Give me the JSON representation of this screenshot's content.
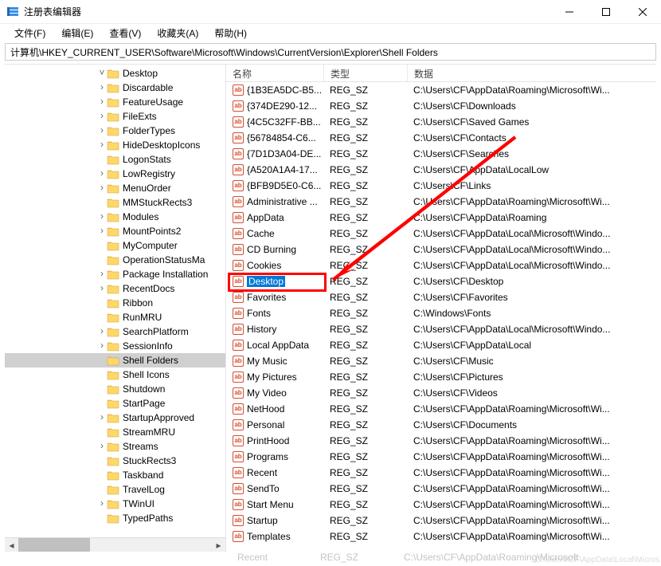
{
  "window": {
    "title": "注册表编辑器",
    "min_label": "minimize",
    "max_label": "maximize",
    "close_label": "close"
  },
  "menu": {
    "file": "文件(F)",
    "edit": "编辑(E)",
    "view": "查看(V)",
    "fav": "收藏夹(A)",
    "help": "帮助(H)"
  },
  "address": "计算机\\HKEY_CURRENT_USER\\Software\\Microsoft\\Windows\\CurrentVersion\\Explorer\\Shell Folders",
  "tree": [
    {
      "label": "Desktop",
      "chev": "v"
    },
    {
      "label": "Discardable",
      "chev": ">"
    },
    {
      "label": "FeatureUsage",
      "chev": ">"
    },
    {
      "label": "FileExts",
      "chev": ">"
    },
    {
      "label": "FolderTypes",
      "chev": ">"
    },
    {
      "label": "HideDesktopIcons",
      "chev": ">"
    },
    {
      "label": "LogonStats",
      "chev": ""
    },
    {
      "label": "LowRegistry",
      "chev": ">"
    },
    {
      "label": "MenuOrder",
      "chev": ">"
    },
    {
      "label": "MMStuckRects3",
      "chev": ""
    },
    {
      "label": "Modules",
      "chev": ">"
    },
    {
      "label": "MountPoints2",
      "chev": ">"
    },
    {
      "label": "MyComputer",
      "chev": ""
    },
    {
      "label": "OperationStatusMa",
      "chev": ""
    },
    {
      "label": "Package Installation",
      "chev": ">"
    },
    {
      "label": "RecentDocs",
      "chev": ">"
    },
    {
      "label": "Ribbon",
      "chev": ""
    },
    {
      "label": "RunMRU",
      "chev": ""
    },
    {
      "label": "SearchPlatform",
      "chev": ">"
    },
    {
      "label": "SessionInfo",
      "chev": ">"
    },
    {
      "label": "Shell Folders",
      "chev": "",
      "selected": true
    },
    {
      "label": "Shell Icons",
      "chev": ""
    },
    {
      "label": "Shutdown",
      "chev": ""
    },
    {
      "label": "StartPage",
      "chev": ""
    },
    {
      "label": "StartupApproved",
      "chev": ">"
    },
    {
      "label": "StreamMRU",
      "chev": ""
    },
    {
      "label": "Streams",
      "chev": ">"
    },
    {
      "label": "StuckRects3",
      "chev": ""
    },
    {
      "label": "Taskband",
      "chev": ""
    },
    {
      "label": "TravelLog",
      "chev": ""
    },
    {
      "label": "TWinUI",
      "chev": ">"
    },
    {
      "label": "TypedPaths",
      "chev": ""
    }
  ],
  "columns": {
    "name": "名称",
    "type": "类型",
    "data": "数据"
  },
  "rows": [
    {
      "name": "{1B3EA5DC-B5...",
      "type": "REG_SZ",
      "data": "C:\\Users\\CF\\AppData\\Roaming\\Microsoft\\Wi..."
    },
    {
      "name": "{374DE290-12...",
      "type": "REG_SZ",
      "data": "C:\\Users\\CF\\Downloads"
    },
    {
      "name": "{4C5C32FF-BB...",
      "type": "REG_SZ",
      "data": "C:\\Users\\CF\\Saved Games"
    },
    {
      "name": "{56784854-C6...",
      "type": "REG_SZ",
      "data": "C:\\Users\\CF\\Contacts"
    },
    {
      "name": "{7D1D3A04-DE...",
      "type": "REG_SZ",
      "data": "C:\\Users\\CF\\Searches"
    },
    {
      "name": "{A520A1A4-17...",
      "type": "REG_SZ",
      "data": "C:\\Users\\CF\\AppData\\LocalLow"
    },
    {
      "name": "{BFB9D5E0-C6...",
      "type": "REG_SZ",
      "data": "C:\\Users\\CF\\Links"
    },
    {
      "name": "Administrative ...",
      "type": "REG_SZ",
      "data": "C:\\Users\\CF\\AppData\\Roaming\\Microsoft\\Wi..."
    },
    {
      "name": "AppData",
      "type": "REG_SZ",
      "data": "C:\\Users\\CF\\AppData\\Roaming"
    },
    {
      "name": "Cache",
      "type": "REG_SZ",
      "data": "C:\\Users\\CF\\AppData\\Local\\Microsoft\\Windo..."
    },
    {
      "name": "CD Burning",
      "type": "REG_SZ",
      "data": "C:\\Users\\CF\\AppData\\Local\\Microsoft\\Windo..."
    },
    {
      "name": "Cookies",
      "type": "REG_SZ",
      "data": "C:\\Users\\CF\\AppData\\Local\\Microsoft\\Windo..."
    },
    {
      "name": "Desktop",
      "type": "REG_SZ",
      "data": "C:\\Users\\CF\\Desktop",
      "hl": true
    },
    {
      "name": "Favorites",
      "type": "REG_SZ",
      "data": "C:\\Users\\CF\\Favorites"
    },
    {
      "name": "Fonts",
      "type": "REG_SZ",
      "data": "C:\\Windows\\Fonts"
    },
    {
      "name": "History",
      "type": "REG_SZ",
      "data": "C:\\Users\\CF\\AppData\\Local\\Microsoft\\Windo..."
    },
    {
      "name": "Local AppData",
      "type": "REG_SZ",
      "data": "C:\\Users\\CF\\AppData\\Local"
    },
    {
      "name": "My Music",
      "type": "REG_SZ",
      "data": "C:\\Users\\CF\\Music"
    },
    {
      "name": "My Pictures",
      "type": "REG_SZ",
      "data": "C:\\Users\\CF\\Pictures"
    },
    {
      "name": "My Video",
      "type": "REG_SZ",
      "data": "C:\\Users\\CF\\Videos"
    },
    {
      "name": "NetHood",
      "type": "REG_SZ",
      "data": "C:\\Users\\CF\\AppData\\Roaming\\Microsoft\\Wi..."
    },
    {
      "name": "Personal",
      "type": "REG_SZ",
      "data": "C:\\Users\\CF\\Documents"
    },
    {
      "name": "PrintHood",
      "type": "REG_SZ",
      "data": "C:\\Users\\CF\\AppData\\Roaming\\Microsoft\\Wi..."
    },
    {
      "name": "Programs",
      "type": "REG_SZ",
      "data": "C:\\Users\\CF\\AppData\\Roaming\\Microsoft\\Wi..."
    },
    {
      "name": "Recent",
      "type": "REG_SZ",
      "data": "C:\\Users\\CF\\AppData\\Roaming\\Microsoft\\Wi..."
    },
    {
      "name": "SendTo",
      "type": "REG_SZ",
      "data": "C:\\Users\\CF\\AppData\\Roaming\\Microsoft\\Wi..."
    },
    {
      "name": "Start Menu",
      "type": "REG_SZ",
      "data": "C:\\Users\\CF\\AppData\\Roaming\\Microsoft\\Wi..."
    },
    {
      "name": "Startup",
      "type": "REG_SZ",
      "data": "C:\\Users\\CF\\AppData\\Roaming\\Microsoft\\Wi..."
    },
    {
      "name": "Templates",
      "type": "REG_SZ",
      "data": "C:\\Users\\CF\\AppData\\Roaming\\Microsoft\\Wi..."
    }
  ],
  "ghost_below": {
    "name": "Recent",
    "type": "REG_SZ",
    "data": "C:\\Users\\CF\\AppData\\Roaming\\Microsoft"
  },
  "ghost_right": "C:\\Users\\CF\\AppData\\Local\\Micros"
}
